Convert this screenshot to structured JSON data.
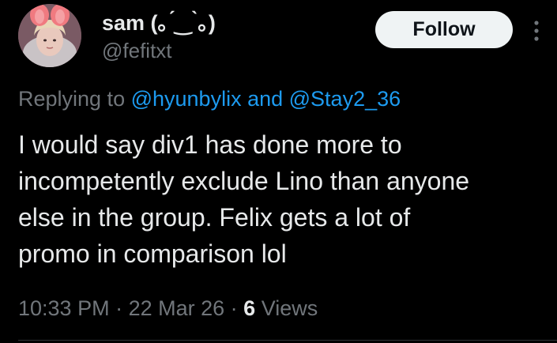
{
  "user": {
    "display_name": "sam (｡ ́‿ ̀｡)",
    "handle": "@fefitxt",
    "avatar_icon": "profile-photo"
  },
  "follow_button": {
    "label": "Follow"
  },
  "more_menu": {
    "icon": "vertical-ellipsis-icon"
  },
  "reply": {
    "prefix": "Replying to ",
    "mention_1": "@hyunbylix",
    "connector": " and ",
    "mention_2": "@Stay2_36"
  },
  "tweet": {
    "text": "I would say div1 has done more to\nincompetently exclude Lino than anyone\nelse in the group.  Felix gets a lot of\npromo in comparison lol"
  },
  "meta": {
    "time": "10:33 PM",
    "separator": " · ",
    "date": "22 Mar 26",
    "views_count": "6",
    "views_label": " Views"
  },
  "colors": {
    "background": "#000000",
    "text_primary": "#e7e9ea",
    "text_secondary": "#71767b",
    "link": "#1d9bf0",
    "button_bg": "#eff3f4"
  }
}
